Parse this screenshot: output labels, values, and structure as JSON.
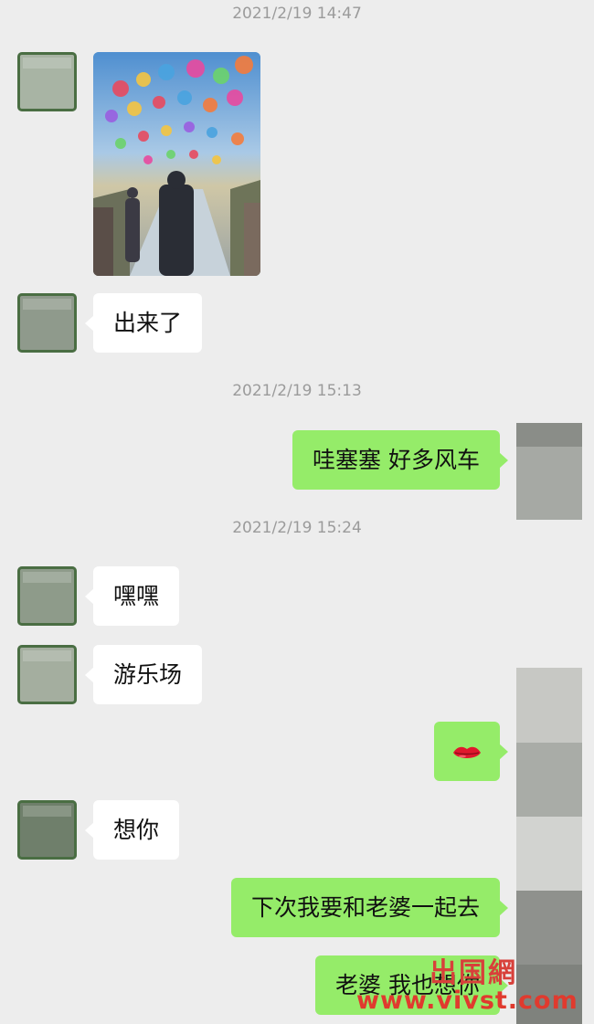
{
  "timestamps": [
    "2021/2/19 14:47",
    "2021/2/19 15:13",
    "2021/2/19 15:24"
  ],
  "messages": {
    "m1": "出来了",
    "m2": "哇塞塞 好多风车",
    "m3": "嘿嘿",
    "m4": "游乐场",
    "m5_icon": "lips-emoji-icon",
    "m6": "想你",
    "m7": "下次我要和老婆一起去",
    "m8": "老婆 我也想你"
  },
  "watermark": {
    "top": "出国網",
    "url": "www.vivst.com"
  },
  "colors": {
    "background": "#ededed",
    "sent_bubble": "#95ec69",
    "received_bubble": "#ffffff",
    "timestamp": "#9b9b9b",
    "watermark": "#e03a2e"
  }
}
